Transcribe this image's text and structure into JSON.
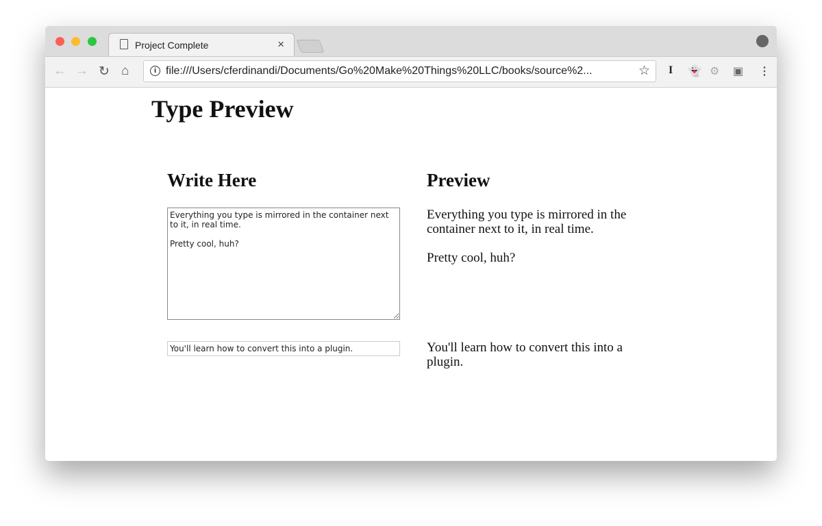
{
  "browser": {
    "tab_title": "Project Complete",
    "url": "file:///Users/cferdinandi/Documents/Go%20Make%20Things%20LLC/books/source%2..."
  },
  "page": {
    "title": "Type Preview",
    "write_heading": "Write Here",
    "preview_heading": "Preview",
    "textarea_value": "Everything you type is mirrored in the container next to it, in real time.\n\nPretty cool, huh?",
    "input_value": "You'll learn how to convert this into a plugin.",
    "preview_1": "Everything you type is mirrored in the container next to it, in real time.\n\nPretty cool, huh?",
    "preview_2": "You'll learn how to convert this into a plugin."
  }
}
